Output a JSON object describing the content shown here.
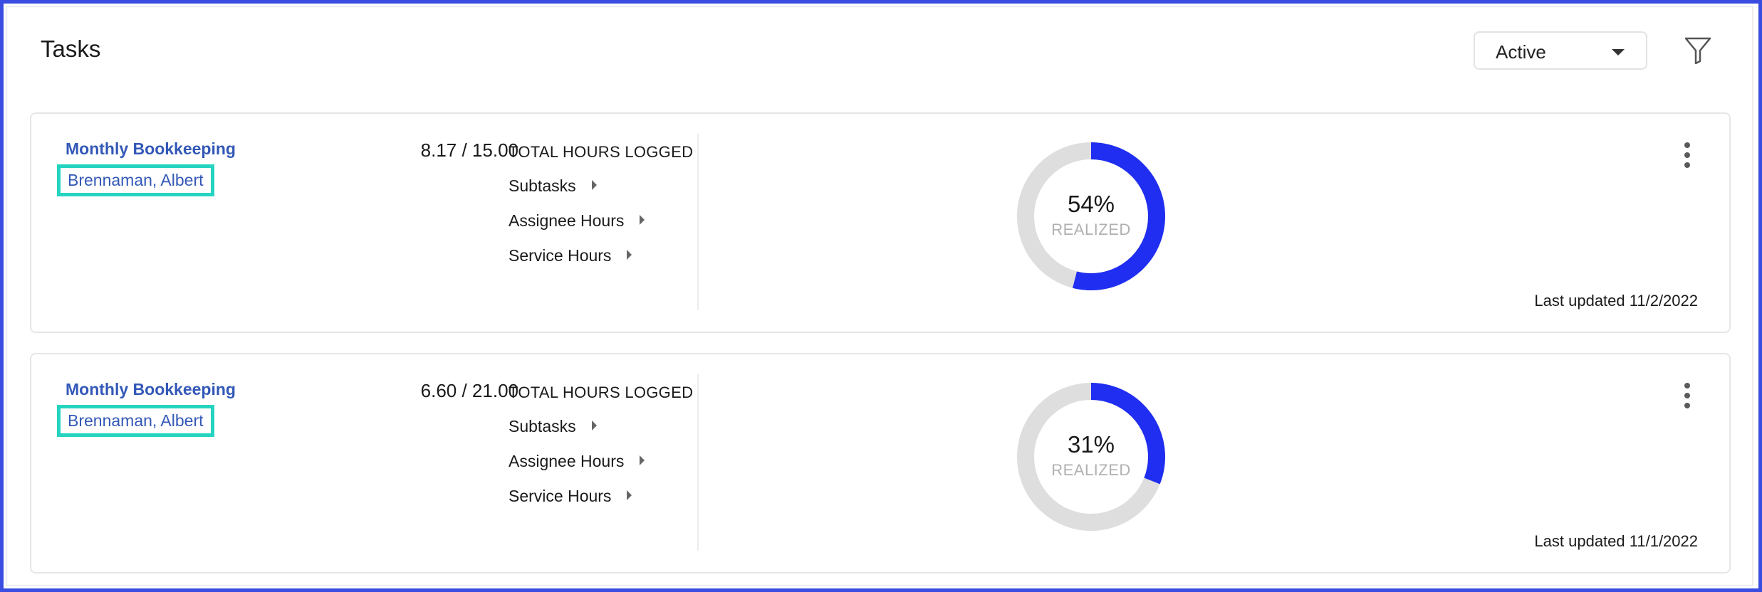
{
  "header": {
    "title": "Tasks",
    "status_filter": "Active"
  },
  "colors": {
    "accent": "#1f2ef0",
    "track": "#dedede",
    "link": "#3358b7",
    "highlight": "#24d4c0"
  },
  "tasks": [
    {
      "name": "Monthly Bookkeeping",
      "assignee": "Brennaman, Albert",
      "hours": "8.17 / 15.00",
      "hours_label": "TOTAL HOURS LOGGED",
      "expanders": [
        "Subtasks",
        "Assignee Hours",
        "Service Hours"
      ],
      "realized_value": 54,
      "realized_pct": "54%",
      "realized_label": "REALIZED",
      "last_updated": "Last updated 11/2/2022"
    },
    {
      "name": "Monthly Bookkeeping",
      "assignee": "Brennaman, Albert",
      "hours": "6.60 / 21.00",
      "hours_label": "TOTAL HOURS LOGGED",
      "expanders": [
        "Subtasks",
        "Assignee Hours",
        "Service Hours"
      ],
      "realized_value": 31,
      "realized_pct": "31%",
      "realized_label": "REALIZED",
      "last_updated": "Last updated 11/1/2022"
    }
  ]
}
